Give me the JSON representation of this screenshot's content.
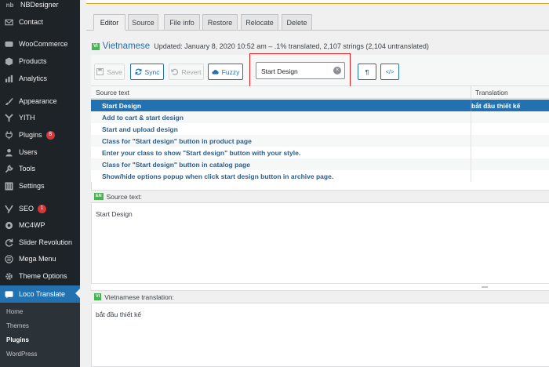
{
  "sidebar": {
    "items": [
      {
        "label": "NBDesigner",
        "icon": "nb-logo-icon"
      },
      {
        "label": "Contact",
        "icon": "envelope-icon"
      },
      {
        "label": "WooCommerce",
        "icon": "woo-icon"
      },
      {
        "label": "Products",
        "icon": "box-icon"
      },
      {
        "label": "Analytics",
        "icon": "bar-chart-icon"
      },
      {
        "label": "Appearance",
        "icon": "paintbrush-icon"
      },
      {
        "label": "YITH",
        "icon": "yith-icon"
      },
      {
        "label": "Plugins",
        "icon": "plug-icon",
        "badge": "8"
      },
      {
        "label": "Users",
        "icon": "user-icon"
      },
      {
        "label": "Tools",
        "icon": "wrench-icon"
      },
      {
        "label": "Settings",
        "icon": "sliders-icon"
      },
      {
        "label": "SEO",
        "icon": "yoast-icon",
        "badge": "1"
      },
      {
        "label": "MC4WP",
        "icon": "mc4wp-icon"
      },
      {
        "label": "Slider Revolution",
        "icon": "refresh-icon"
      },
      {
        "label": "Mega Menu",
        "icon": "megamenu-icon"
      },
      {
        "label": "Theme Options",
        "icon": "gear-icon"
      },
      {
        "label": "Loco Translate",
        "icon": "loco-icon"
      }
    ],
    "submenu": [
      "Home",
      "Themes",
      "Plugins",
      "WordPress"
    ]
  },
  "tabs": [
    "Editor",
    "Source",
    "File info",
    "Restore",
    "Relocate",
    "Delete"
  ],
  "locale": {
    "tag": "VI",
    "name": "Vietnamese",
    "meta": "Updated: January 8, 2020 10:52 am – .1% translated, 2,107 strings (2,104 untranslated)"
  },
  "toolbar": {
    "save": "Save",
    "sync": "Sync",
    "revert": "Revert",
    "fuzzy": "Fuzzy",
    "search_value": "Start Design",
    "pilcrow": "¶",
    "code": "</>"
  },
  "grid": {
    "col_source": "Source text",
    "col_translation": "Translation",
    "rows": [
      {
        "source": "Start Design",
        "translation": "bắt đầu thiết kế"
      },
      {
        "source": "Add to cart & start design",
        "translation": ""
      },
      {
        "source": "Start and upload design",
        "translation": ""
      },
      {
        "source": "Class for \"Start design\" button in product page",
        "translation": ""
      },
      {
        "source": "Enter your class to show \"Start design\" button with your style.",
        "translation": ""
      },
      {
        "source": "Class for \"Start design\" button in catalog page",
        "translation": ""
      },
      {
        "source": "Show/hide options popup when click start design button in archive page.",
        "translation": ""
      }
    ]
  },
  "source_panel": {
    "tag": "EN",
    "label": "Source text:",
    "text": "Start Design"
  },
  "translation_panel": {
    "tag": "VI",
    "label": "Vietnamese translation:",
    "text": "bắt đầu thiết kế"
  },
  "colors": {
    "accent": "#2271b1",
    "sidebar_bg": "#1d2327",
    "badge": "#d63638",
    "lang_tag": "#46b450",
    "highlight": "#e11d1d"
  }
}
